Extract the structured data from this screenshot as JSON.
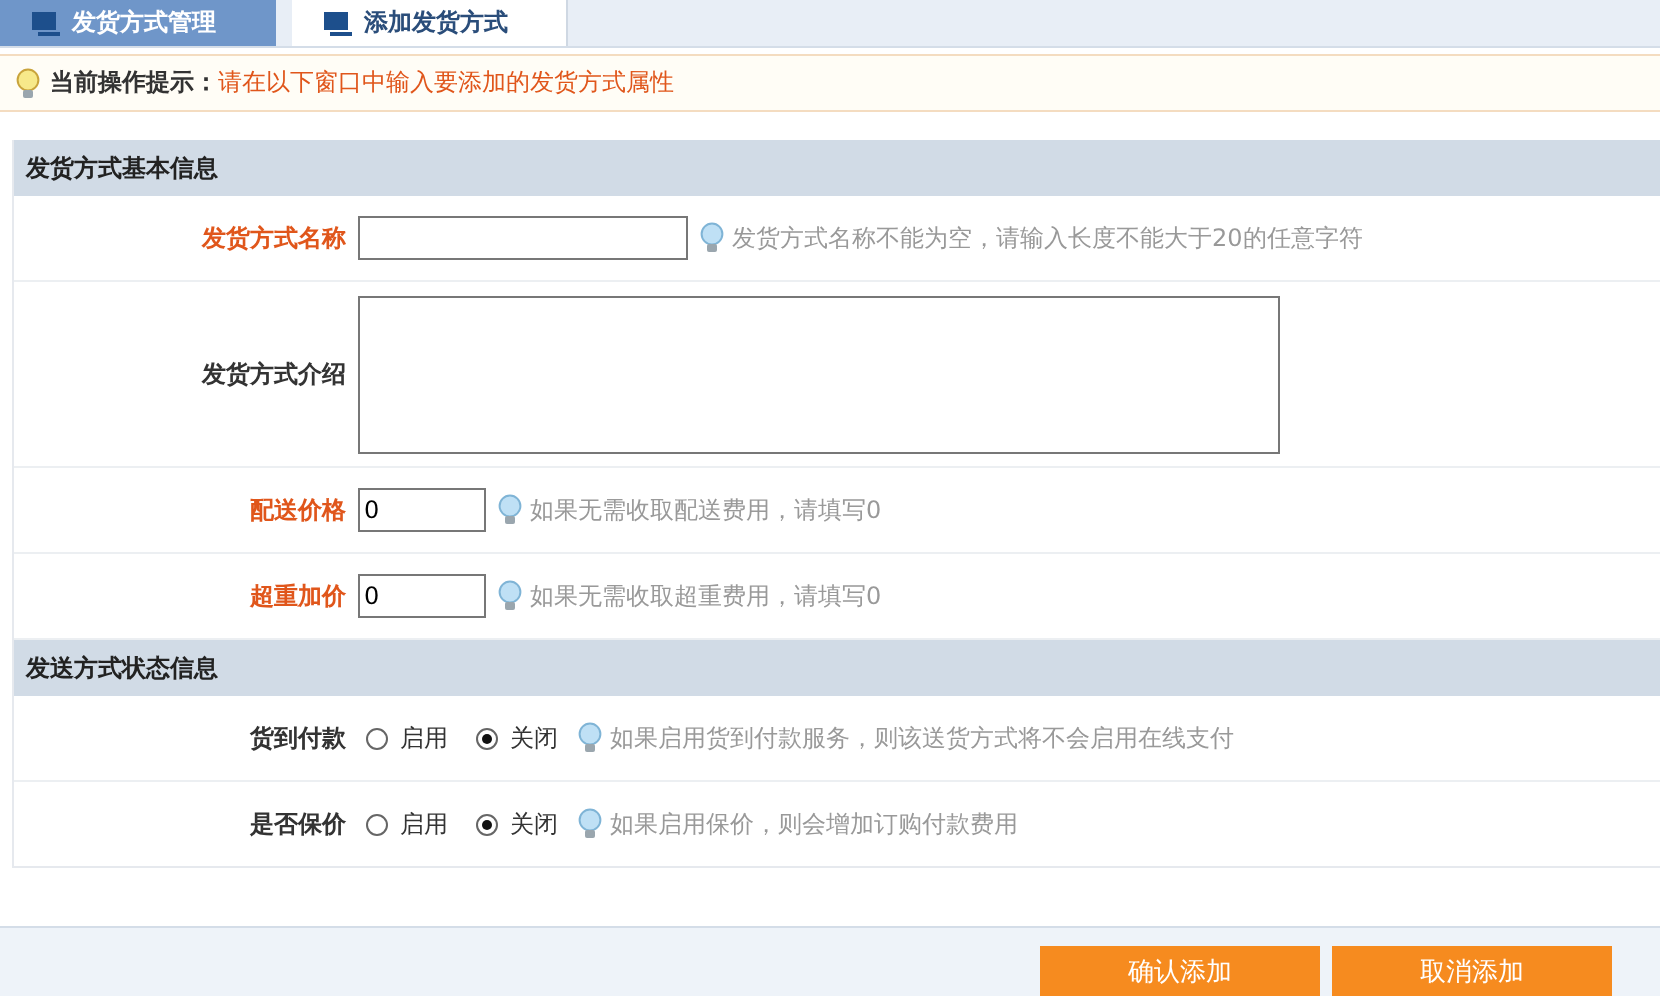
{
  "tabs": [
    {
      "label": "发货方式管理",
      "selected": false
    },
    {
      "label": "添加发货方式",
      "selected": true
    }
  ],
  "tip": {
    "label": "当前操作提示：",
    "text": "请在以下窗口中输入要添加的发货方式属性"
  },
  "sections": [
    {
      "title": "发货方式基本信息",
      "rows": [
        {
          "kind": "text",
          "label": "发货方式名称",
          "required": true,
          "value": "",
          "hint": "发货方式名称不能为空，请输入长度不能大于20的任意字符"
        },
        {
          "kind": "textarea",
          "label": "发货方式介绍",
          "required": false,
          "value": ""
        },
        {
          "kind": "number",
          "label": "配送价格",
          "required": true,
          "value": "0",
          "hint": "如果无需收取配送费用，请填写0"
        },
        {
          "kind": "number",
          "label": "超重加价",
          "required": true,
          "value": "0",
          "hint": "如果无需收取超重费用，请填写0"
        }
      ]
    },
    {
      "title": "发送方式状态信息",
      "rows": [
        {
          "kind": "radio",
          "label": "货到付款",
          "required": false,
          "options": [
            {
              "label": "启用",
              "selected": false
            },
            {
              "label": "关闭",
              "selected": true
            }
          ],
          "hint": "如果启用货到付款服务，则该送货方式将不会启用在线支付"
        },
        {
          "kind": "radio",
          "label": "是否保价",
          "required": false,
          "options": [
            {
              "label": "启用",
              "selected": false
            },
            {
              "label": "关闭",
              "selected": true
            }
          ],
          "hint": "如果启用保价，则会增加订购付款费用"
        }
      ]
    }
  ],
  "buttons": [
    "确认添加",
    "取消添加"
  ]
}
